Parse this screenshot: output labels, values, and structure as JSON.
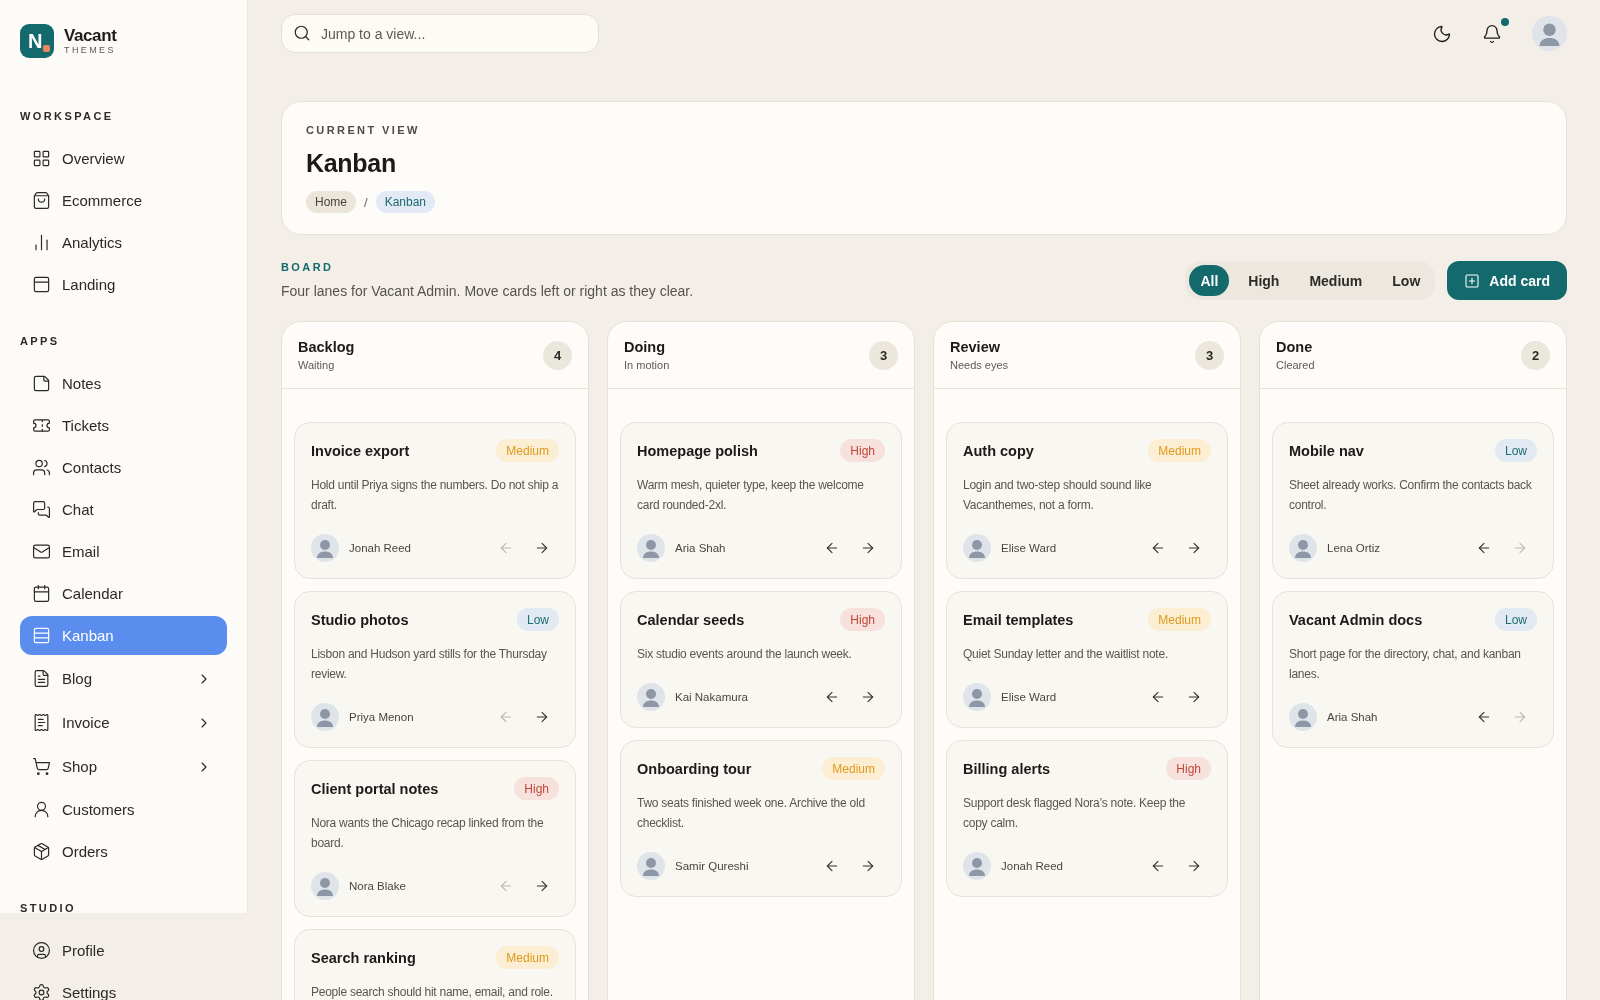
{
  "sidebar": {
    "logo": {
      "mark": "N",
      "name": "Vacant",
      "tagline": "THEMES"
    },
    "sections": [
      {
        "title": "WORKSPACE",
        "items": [
          {
            "label": "Overview",
            "kind": "link",
            "selected": false
          },
          {
            "label": "Ecommerce",
            "kind": "link",
            "selected": false
          },
          {
            "label": "Analytics",
            "kind": "link",
            "selected": false
          },
          {
            "label": "Landing",
            "kind": "link",
            "selected": false
          }
        ]
      },
      {
        "title": "APPS",
        "items": [
          {
            "label": "Notes",
            "kind": "link",
            "selected": false
          },
          {
            "label": "Tickets",
            "kind": "link",
            "selected": false
          },
          {
            "label": "Contacts",
            "kind": "link",
            "selected": false
          },
          {
            "label": "Chat",
            "kind": "link",
            "selected": false
          },
          {
            "label": "Email",
            "kind": "link",
            "selected": false
          },
          {
            "label": "Calendar",
            "kind": "link",
            "selected": false
          },
          {
            "label": "Kanban",
            "kind": "link",
            "selected": true
          },
          {
            "label": "Blog",
            "kind": "group",
            "selected": false
          },
          {
            "label": "Invoice",
            "kind": "group",
            "selected": false
          },
          {
            "label": "Shop",
            "kind": "group",
            "selected": false
          },
          {
            "label": "Customers",
            "kind": "link",
            "selected": false
          },
          {
            "label": "Orders",
            "kind": "link",
            "selected": false
          }
        ]
      },
      {
        "title": "STUDIO",
        "items": [
          {
            "label": "Profile",
            "kind": "link",
            "selected": false
          },
          {
            "label": "Settings",
            "kind": "link",
            "selected": false
          }
        ]
      }
    ]
  },
  "topbar": {
    "search": {
      "placeholder": "Jump to a view..."
    },
    "notifications": {
      "unread": true
    }
  },
  "header": {
    "eyebrow": "CURRENT VIEW",
    "title": "Kanban",
    "breadcrumb": {
      "separator": "/",
      "items": [
        {
          "label": "Home",
          "current": false
        },
        {
          "label": "Kanban",
          "current": true
        }
      ]
    }
  },
  "board": {
    "eyebrow": "BOARD",
    "description": "Four lanes for Vacant Admin. Move cards left or right as they clear.",
    "filters": [
      {
        "label": "All",
        "selected": true
      },
      {
        "label": "High",
        "selected": false
      },
      {
        "label": "Medium",
        "selected": false
      },
      {
        "label": "Low",
        "selected": false
      }
    ],
    "add_button": {
      "label": "Add card"
    },
    "lanes": [
      {
        "title": "Backlog",
        "subtitle": "Waiting",
        "count": "4",
        "cards": [
          {
            "title": "Invoice export",
            "tag": {
              "label": "Medium",
              "kind": "medium"
            },
            "text": "Hold until Priya signs the numbers. Do not ship a draft.",
            "assignee": "Jonah Reed",
            "left_disabled": true,
            "right_disabled": false
          },
          {
            "title": "Studio photos",
            "tag": {
              "label": "Low",
              "kind": "low"
            },
            "text": "Lisbon and Hudson yard stills for the Thursday review.",
            "assignee": "Priya Menon",
            "left_disabled": true,
            "right_disabled": false
          },
          {
            "title": "Client portal notes",
            "tag": {
              "label": "High",
              "kind": "high"
            },
            "text": "Nora wants the Chicago recap linked from the board.",
            "assignee": "Nora Blake",
            "left_disabled": true,
            "right_disabled": false
          },
          {
            "title": "Search ranking",
            "tag": {
              "label": "Medium",
              "kind": "medium"
            },
            "text": "People search should hit name, email, and role."
          }
        ]
      },
      {
        "title": "Doing",
        "subtitle": "In motion",
        "count": "3",
        "cards": [
          {
            "title": "Homepage polish",
            "tag": {
              "label": "High",
              "kind": "high"
            },
            "text": "Warm mesh, quieter type, keep the welcome card rounded-2xl.",
            "assignee": "Aria Shah",
            "left_disabled": false,
            "right_disabled": false
          },
          {
            "title": "Calendar seeds",
            "tag": {
              "label": "High",
              "kind": "high"
            },
            "text": "Six studio events around the launch week.",
            "assignee": "Kai Nakamura",
            "left_disabled": false,
            "right_disabled": false
          },
          {
            "title": "Onboarding tour",
            "tag": {
              "label": "Medium",
              "kind": "medium"
            },
            "text": "Two seats finished week one. Archive the old checklist.",
            "assignee": "Samir Qureshi",
            "left_disabled": false,
            "right_disabled": false
          }
        ]
      },
      {
        "title": "Review",
        "subtitle": "Needs eyes",
        "count": "3",
        "cards": [
          {
            "title": "Auth copy",
            "tag": {
              "label": "Medium",
              "kind": "medium"
            },
            "text": "Login and two-step should sound like Vacanthemes, not a form.",
            "assignee": "Elise Ward",
            "left_disabled": false,
            "right_disabled": false
          },
          {
            "title": "Email templates",
            "tag": {
              "label": "Medium",
              "kind": "medium"
            },
            "text": "Quiet Sunday letter and the waitlist note.",
            "assignee": "Elise Ward",
            "left_disabled": false,
            "right_disabled": false
          },
          {
            "title": "Billing alerts",
            "tag": {
              "label": "High",
              "kind": "high"
            },
            "text": "Support desk flagged Nora’s note. Keep the copy calm.",
            "assignee": "Jonah Reed",
            "left_disabled": false,
            "right_disabled": false
          }
        ]
      },
      {
        "title": "Done",
        "subtitle": "Cleared",
        "count": "2",
        "cards": [
          {
            "title": "Mobile nav",
            "tag": {
              "label": "Low",
              "kind": "low"
            },
            "text": "Sheet already works. Confirm the contacts back control.",
            "assignee": "Lena Ortiz",
            "left_disabled": false,
            "right_disabled": true
          },
          {
            "title": "Vacant Admin docs",
            "tag": {
              "label": "Low",
              "kind": "low"
            },
            "text": "Short page for the directory, chat, and kanban lanes.",
            "assignee": "Aria Shah",
            "left_disabled": false,
            "right_disabled": true
          }
        ]
      }
    ]
  }
}
